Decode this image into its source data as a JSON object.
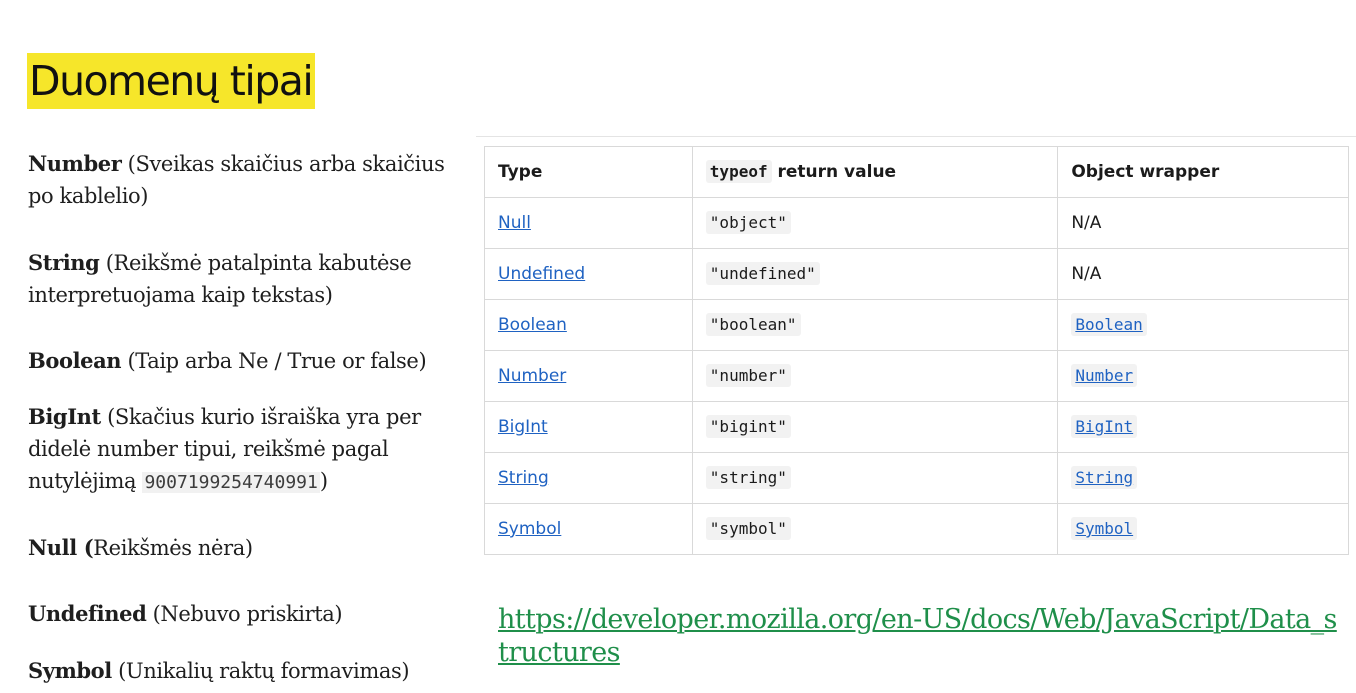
{
  "title": "Duomenų tipai",
  "items": [
    {
      "name": "Number",
      "desc": " (Sveikas skaičius arba skaičius po kablelio)"
    },
    {
      "name": "String",
      "desc": " (Reikšmė patalpinta kabutėse interpretuojama kaip tekstas)"
    },
    {
      "name": "Boolean",
      "desc": " (Taip arba Ne / True or false)"
    },
    {
      "name": "BigInt",
      "desc": " (Skačius kurio išraiška yra per didelė number tipui, reikšmė pagal nutylėjimą ",
      "code": "9007199254740991",
      "after": ")"
    },
    {
      "name": "Null (",
      "desc": "Reikšmės nėra)"
    },
    {
      "name": "Undefined",
      "desc": " (Nebuvo priskirta)"
    },
    {
      "name": "Symbol",
      "desc": " (Unikalių raktų formavimas)"
    }
  ],
  "table": {
    "headers": {
      "type": "Type",
      "typeof_code": "typeof",
      "typeof_rest": " return value",
      "wrapper": "Object wrapper"
    },
    "rows": [
      {
        "type": "Null",
        "typeof": "\"object\"",
        "wrapper": "N/A",
        "wrapper_link": false
      },
      {
        "type": "Undefined",
        "typeof": "\"undefined\"",
        "wrapper": "N/A",
        "wrapper_link": false
      },
      {
        "type": "Boolean",
        "typeof": "\"boolean\"",
        "wrapper": "Boolean",
        "wrapper_link": true
      },
      {
        "type": "Number",
        "typeof": "\"number\"",
        "wrapper": "Number",
        "wrapper_link": true
      },
      {
        "type": "BigInt",
        "typeof": "\"bigint\"",
        "wrapper": "BigInt",
        "wrapper_link": true
      },
      {
        "type": "String",
        "typeof": "\"string\"",
        "wrapper": "String",
        "wrapper_link": true
      },
      {
        "type": "Symbol",
        "typeof": "\"symbol\"",
        "wrapper": "Symbol",
        "wrapper_link": true
      }
    ]
  },
  "url": "https://developer.mozilla.org/en-US/docs/Web/JavaScript/Data_structures",
  "colors": {
    "highlight": "#f6e62a",
    "link_blue": "#1f62c2",
    "url_green": "#1f8f4a"
  }
}
